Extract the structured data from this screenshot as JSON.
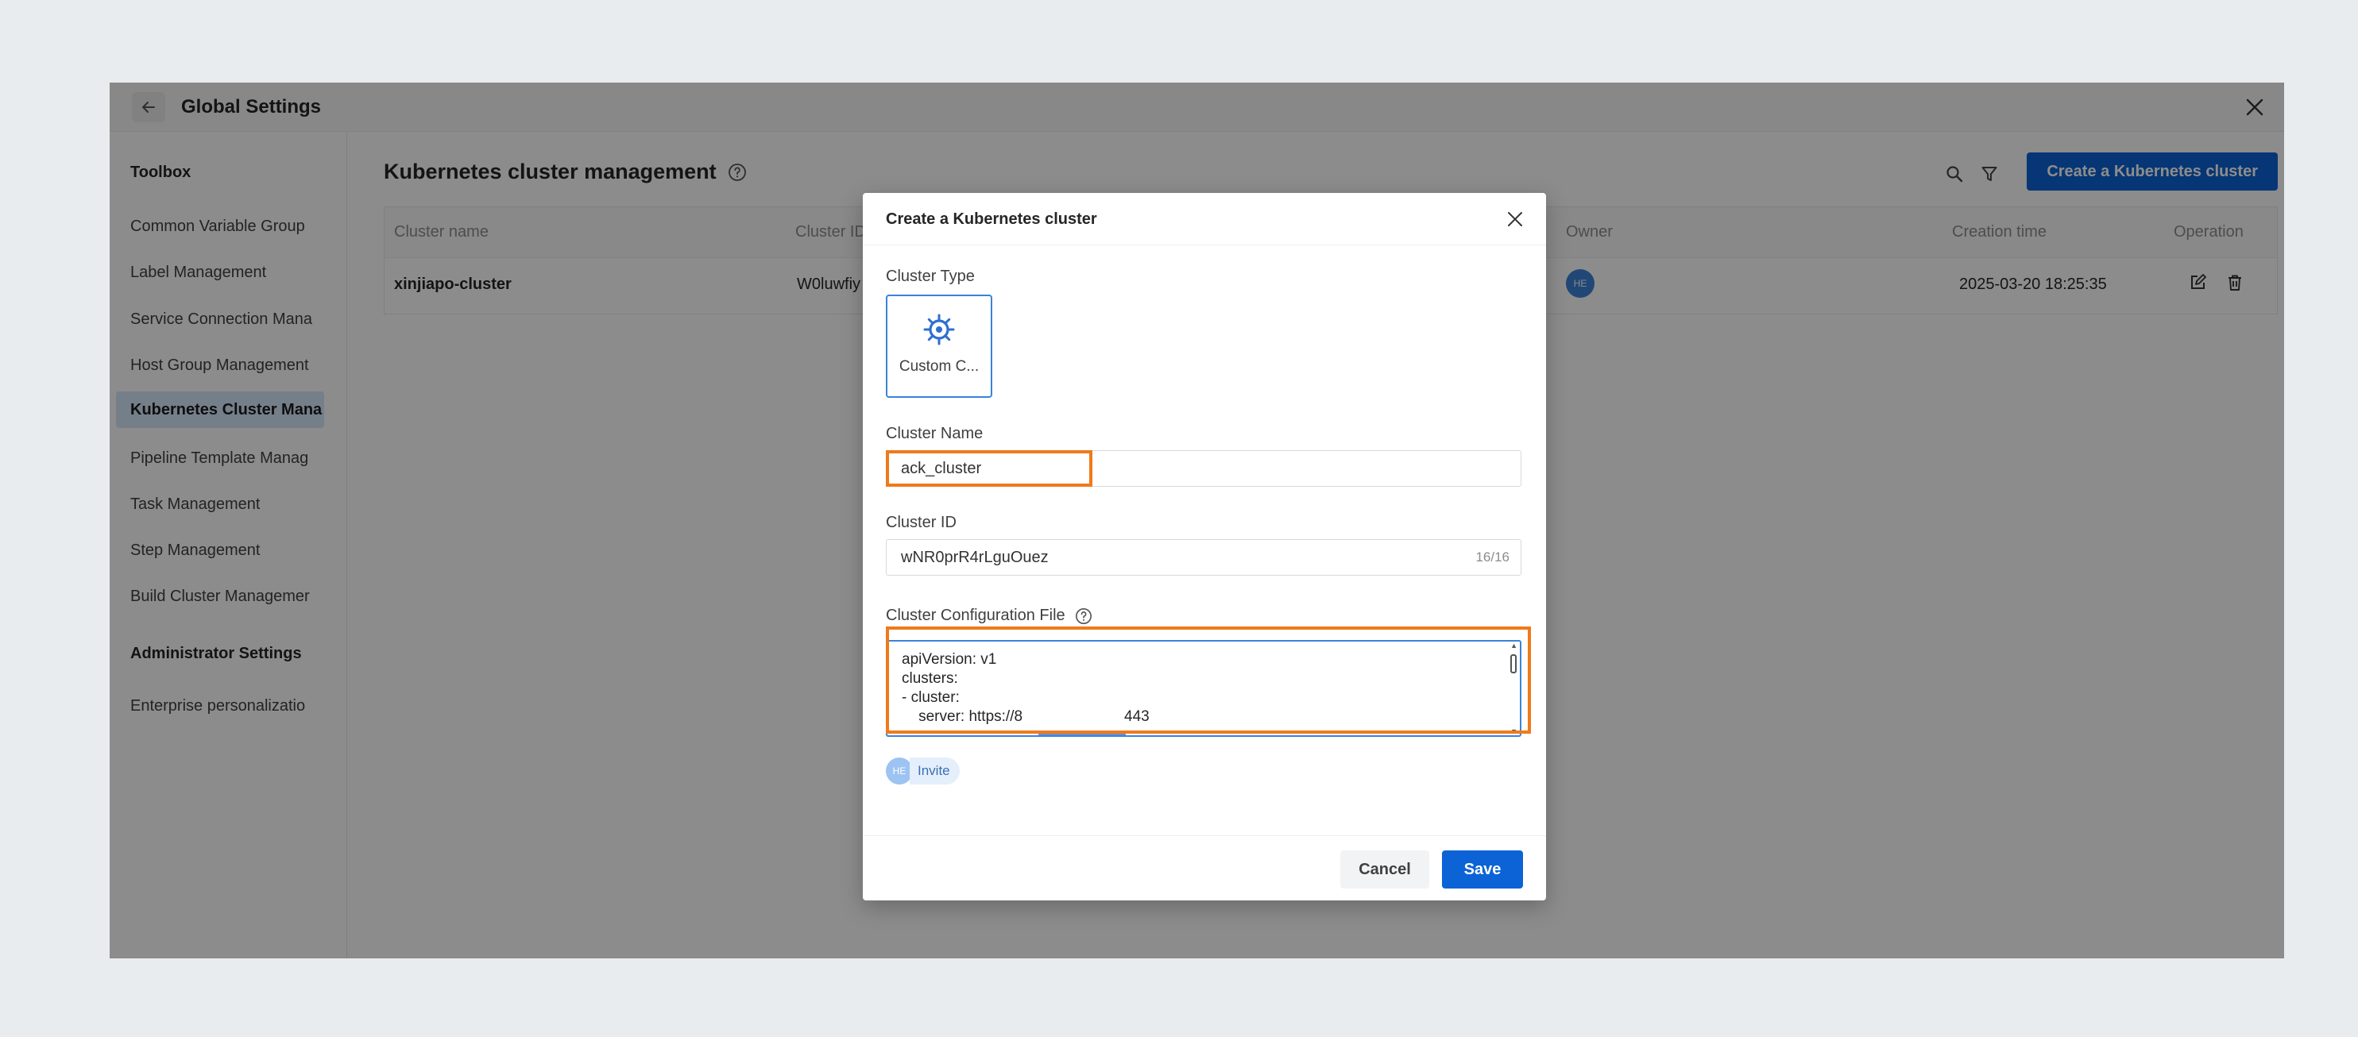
{
  "window": {
    "title": "Global Settings",
    "back_icon": "arrow-left-icon",
    "close_icon": "close-icon"
  },
  "sidebar": {
    "section_toolbox": "Toolbox",
    "items": [
      {
        "label": "Common Variable Group"
      },
      {
        "label": "Label Management"
      },
      {
        "label": "Service Connection Mana"
      },
      {
        "label": "Host Group Management"
      },
      {
        "label": "Kubernetes Cluster Mana",
        "active": true
      },
      {
        "label": "Pipeline Template Manag"
      },
      {
        "label": "Task Management"
      },
      {
        "label": "Step Management"
      },
      {
        "label": "Build Cluster Managemer"
      }
    ],
    "section_admin": "Administrator Settings",
    "admin_items": [
      {
        "label": "Enterprise personalizatio"
      }
    ]
  },
  "main": {
    "title": "Kubernetes cluster management",
    "create_button": "Create a Kubernetes cluster",
    "table": {
      "columns": [
        "Cluster name",
        "Cluster ID",
        "Owner",
        "Creation time",
        "Operation"
      ],
      "rows": [
        {
          "cluster_name": "xinjiapo-cluster",
          "cluster_id": "W0luwfiy",
          "owner_initials": "HE",
          "creation_time": "2025-03-20 18:25:35"
        }
      ]
    }
  },
  "modal": {
    "title": "Create a Kubernetes cluster",
    "cluster_type_label": "Cluster Type",
    "cluster_type_option": "Custom C...",
    "cluster_name_label": "Cluster Name",
    "cluster_name_value": "ack_cluster",
    "cluster_id_label": "Cluster ID",
    "cluster_id_value": "wNR0prR4rLguOuez",
    "cluster_id_counter": "16/16",
    "config_label": "Cluster Configuration File",
    "config_lines": [
      "apiVersion: v1",
      "clusters:",
      "- cluster:",
      "    server: https://8",
      "443"
    ],
    "collaborator_initials": "HE",
    "invite_label": "Invite",
    "cancel_label": "Cancel",
    "save_label": "Save"
  },
  "colors": {
    "primary": "#0b63d6",
    "highlight": "#ef7a1a",
    "active_nav_bg": "#d6e7fb"
  }
}
